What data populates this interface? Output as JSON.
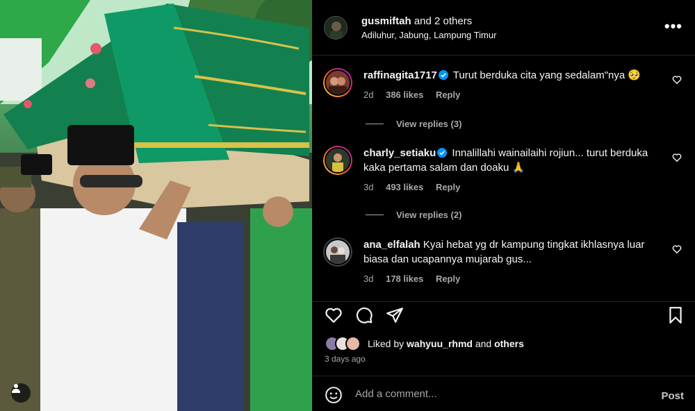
{
  "post": {
    "author": "gusmiftah",
    "coauthors_suffix": "and 2 others",
    "location": "Adiluhur, Jabung, Lampung Timur"
  },
  "comments": [
    {
      "username": "raffinagita1717",
      "verified": true,
      "text": "Turut berduka cita yang sedalam\"nya 🥺",
      "age": "2d",
      "likes": "386 likes",
      "reply_label": "Reply",
      "view_replies": "View replies (3)"
    },
    {
      "username": "charly_setiaku",
      "verified": true,
      "text": "Innalillahi wainailaihi rojiun... turut berduka kaka pertama salam dan doaku 🙏",
      "age": "3d",
      "likes": "493 likes",
      "reply_label": "Reply",
      "view_replies": "View replies (2)"
    },
    {
      "username": "ana_elfalah",
      "verified": false,
      "text": "Kyai hebat yg dr kampung tingkat ikhlasnya luar biasa dan ucapannya mujarab gus...",
      "age": "3d",
      "likes": "178 likes",
      "reply_label": "Reply"
    }
  ],
  "liked_by": {
    "prefix": "Liked by",
    "user": "wahyuu_rhmd",
    "suffix": "and",
    "others": "others"
  },
  "posted_ago": "3 days ago",
  "add_comment": {
    "placeholder": "Add a comment...",
    "post_label": "Post"
  },
  "icons": {
    "header_more": "more-options-icon",
    "like": "heart-icon",
    "comment": "comment-icon",
    "share": "share-icon",
    "save": "bookmark-icon",
    "emoji": "emoji-icon",
    "tag": "user-tag-icon",
    "verified": "verified-badge-icon"
  },
  "colors": {
    "background": "#000000",
    "text": "#f5f5f5",
    "muted": "#a8a8a8",
    "verified": "#0095f6",
    "divider": "#262626"
  }
}
